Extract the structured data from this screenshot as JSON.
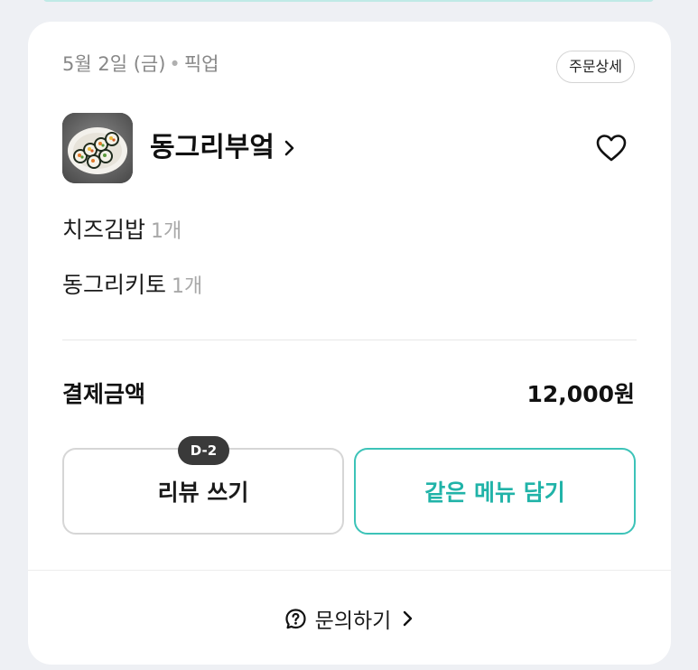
{
  "order": {
    "date": "5월 2일 (금)",
    "separator": "•",
    "type": "픽업",
    "detail_button": "주문상세"
  },
  "store": {
    "name": "동그리부엌",
    "thumbnail_icon": "gimbap-photo",
    "chevron_icon": "chevron-right-icon",
    "favorite_icon": "heart-outline-icon"
  },
  "items": [
    {
      "name": "치즈김밥",
      "qty": "1개"
    },
    {
      "name": "동그리키토",
      "qty": "1개"
    }
  ],
  "payment": {
    "label": "결제금액",
    "amount": "12,000원"
  },
  "actions": {
    "review_label": "리뷰 쓰기",
    "review_badge": "D-2",
    "reorder_label": "같은 메뉴 담기"
  },
  "footer": {
    "inquiry_label": "문의하기",
    "inquiry_icon": "question-circle-icon"
  },
  "colors": {
    "accent": "#20b3a8",
    "accent_border": "#3cc3b8",
    "badge_bg": "#3a3a3a",
    "page_bg": "#eef0f4"
  }
}
